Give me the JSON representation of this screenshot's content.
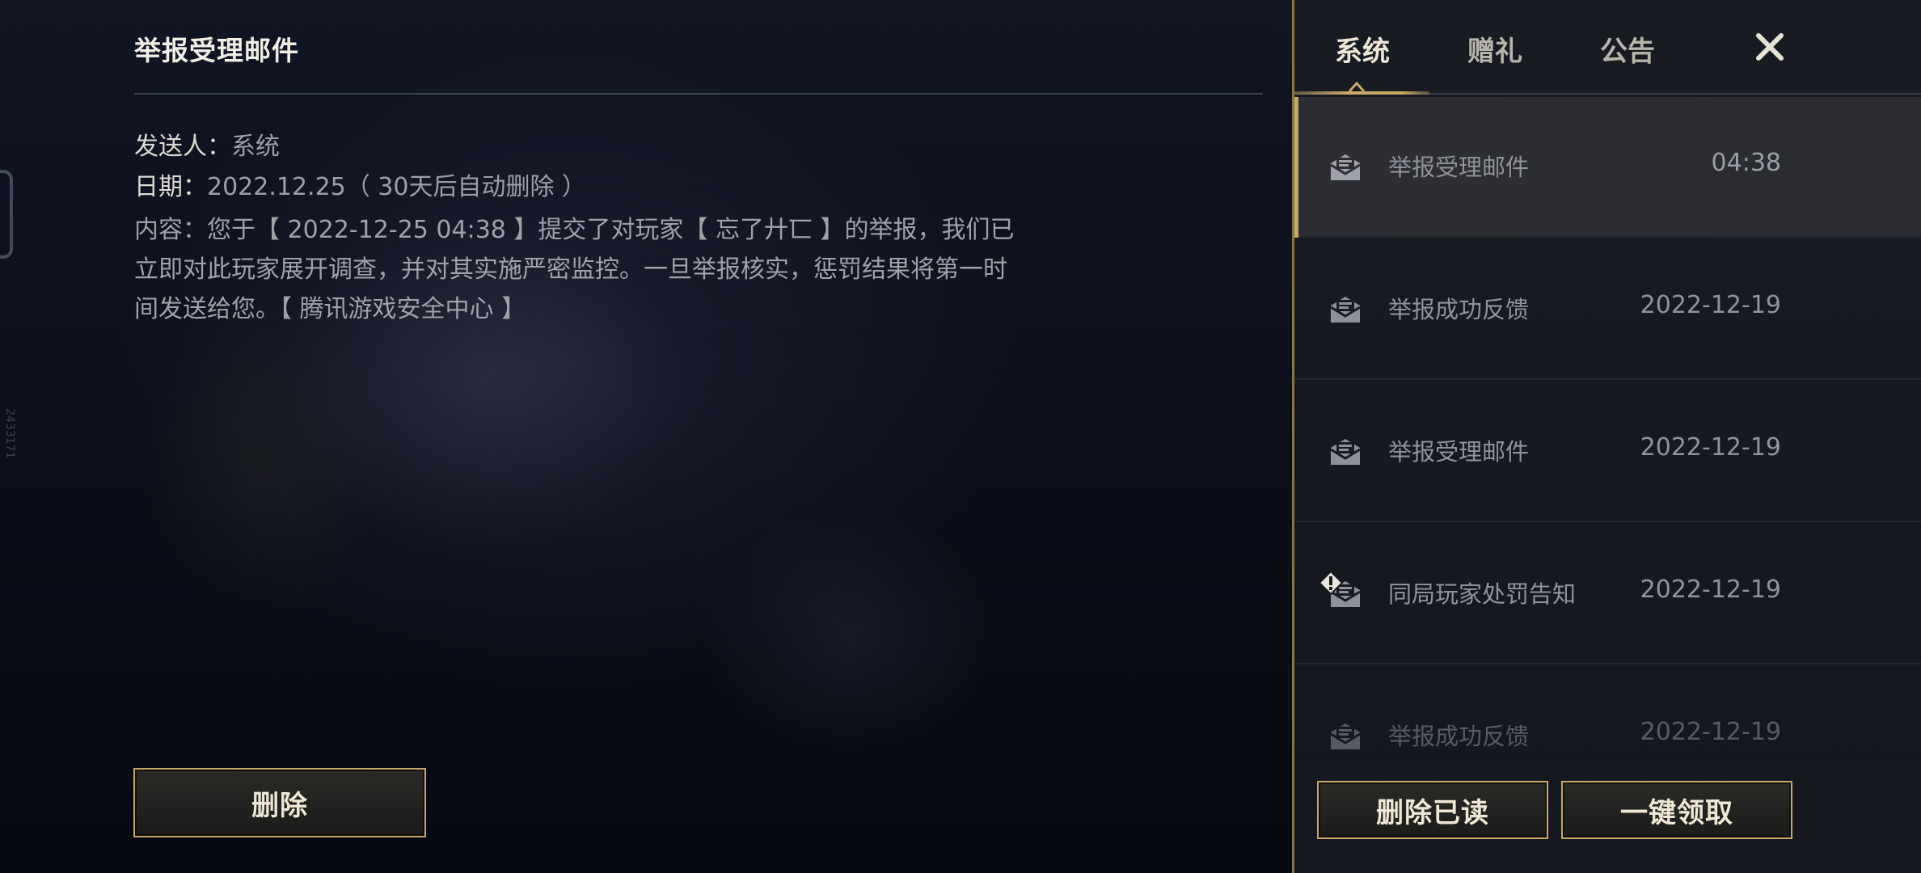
{
  "detail": {
    "title": "举报受理邮件",
    "sender_label": "发送人：",
    "sender_value": "系统",
    "date_label": "日期：",
    "date_value": "2022.12.25（ 30天后自动删除 ）",
    "content_label": "内容：",
    "content_text": "您于【 2022-12-25 04:38 】提交了对玩家【 忘了廾匸 】的举报，我们已立即对此玩家展开调查，并对其实施严密监控。一旦举报核实，惩罚结果将第一时间发送给您。【 腾讯游戏安全中心 】",
    "delete_button": "删除"
  },
  "side_id": "2433171",
  "tabs": {
    "system": "系统",
    "gift": "赠礼",
    "notice": "公告",
    "close": "✕"
  },
  "mail_list": [
    {
      "subject": "举报受理邮件",
      "time": "04:38",
      "icon": "envelope-open-icon"
    },
    {
      "subject": "举报成功反馈",
      "time": "2022-12-19",
      "icon": "envelope-open-icon"
    },
    {
      "subject": "举报受理邮件",
      "time": "2022-12-19",
      "icon": "envelope-open-icon"
    },
    {
      "subject": "同局玩家处罚告知",
      "time": "2022-12-19",
      "icon": "envelope-alert-icon"
    },
    {
      "subject": "举报成功反馈",
      "time": "2022-12-19",
      "icon": "envelope-open-icon"
    }
  ],
  "footer": {
    "delete_read": "删除已读",
    "collect_all": "一键领取"
  },
  "colors": {
    "accent_gold": "#c9a863",
    "panel_bg": "#181b22",
    "text_primary": "#f1eee6",
    "text_muted": "#8f949b"
  }
}
